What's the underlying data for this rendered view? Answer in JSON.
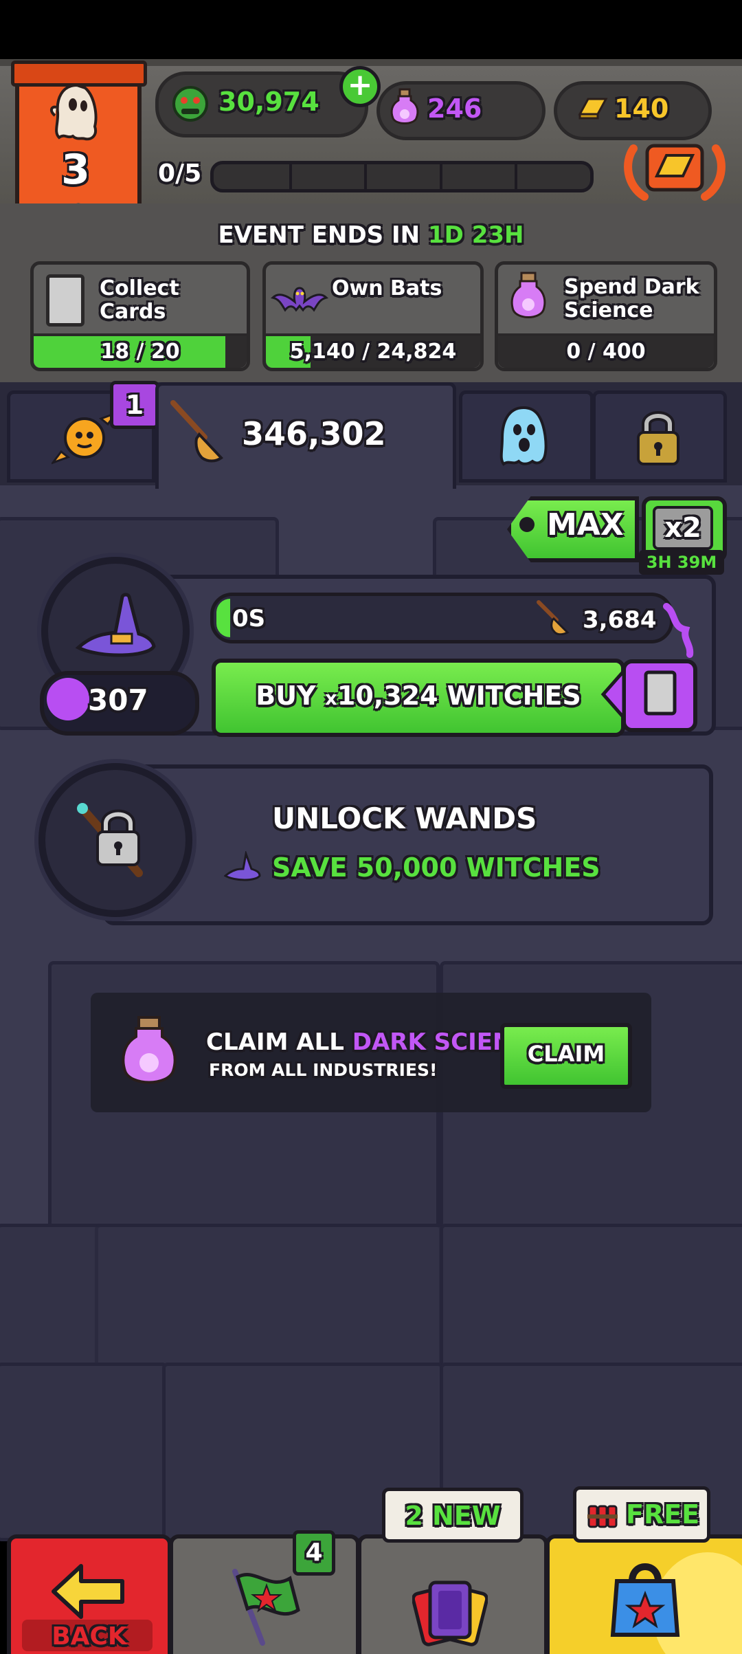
{
  "header": {
    "level": "3",
    "currency_green": "30,974",
    "currency_potion": "246",
    "currency_gold": "140",
    "progress_text": "0/5",
    "progress_value": 0.0,
    "progress_segments": 5
  },
  "event": {
    "ends_label": "EVENT ENDS IN",
    "ends_days": "1D",
    "ends_hours": "23H",
    "tasks": [
      {
        "label": "Collect Cards",
        "progress_text": "18 / 20",
        "progress": 0.9,
        "icon": "card-icon"
      },
      {
        "label": "Own Bats",
        "progress_text": "5,140 / 24,824",
        "progress": 0.207,
        "icon": "bat-icon"
      },
      {
        "label_line1": "Spend Dark",
        "label_line2": "Science",
        "progress_text": "0 / 400",
        "progress": 0.0,
        "icon": "potion-icon"
      }
    ]
  },
  "tabs": {
    "candy_badge": "1",
    "broom_count": "346,302"
  },
  "boost": {
    "max_label": "MAX",
    "multiplier": "x2",
    "timer": "3H 39M"
  },
  "witches": {
    "progress_label": "0S",
    "cost": "3,684",
    "level": "307",
    "buy_label_prefix": "BUY ",
    "buy_label_mult": "x",
    "buy_label_rest": "10,324 WITCHES"
  },
  "wands": {
    "title": "UNLOCK WANDS",
    "requirement": "SAVE 50,000 WITCHES"
  },
  "claim": {
    "line1_white": "CLAIM ALL ",
    "line1_purple": "DARK SCIENCE",
    "line2": "FROM ALL INDUSTRIES!",
    "button": "CLAIM"
  },
  "bottom_nav": {
    "back_label": "BACK",
    "flag_badge": "4",
    "cards_tag": "2 NEW",
    "shop_tag": "FREE"
  },
  "colors": {
    "green": "#4fd23b",
    "purple": "#b84ef2",
    "orange": "#ef5a22",
    "gold": "#f7c52a"
  }
}
